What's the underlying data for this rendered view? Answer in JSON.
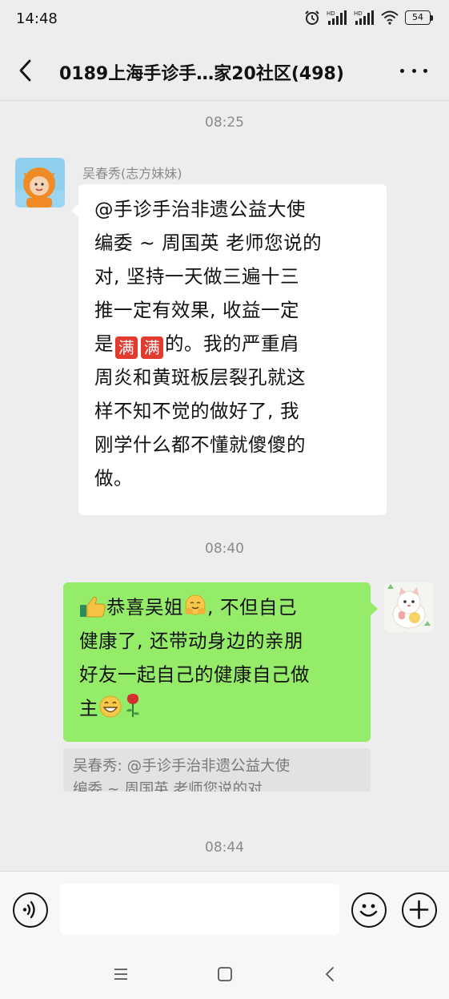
{
  "status_bar": {
    "time": "14:48",
    "battery": "54"
  },
  "nav": {
    "title": "0189上海手诊手…家20社区(498)"
  },
  "messages": {
    "timestamp_1": "08:25",
    "sender_name": "吴春秀(志方妹妹)",
    "incoming_text_lines": [
      "@手诊手治非遗公益大使",
      "编委 ~ 周国英 老师您说的",
      "对, 坚持一天做三遍十三",
      "推一定有效果, 收益一定"
    ],
    "incoming_emoji_char": "满",
    "incoming_line5_prefix": "是",
    "incoming_line5_suffix": "的。我的严重肩",
    "incoming_text_lines_tail": [
      "周炎和黄斑板层裂孔就这",
      "样不知不觉的做好了, 我",
      "刚学什么都不懂就傻傻的",
      "做。"
    ],
    "timestamp_2": "08:40",
    "outgoing_line1_a": "恭喜吴姐",
    "outgoing_line1_b": ", 不但自己",
    "outgoing_line2": "健康了, 还带动身边的亲朋",
    "outgoing_line3": "好友一起自己的健康自己做",
    "outgoing_line4": "主",
    "quote_line1": "吴春秀: @手诊手治非遗公益大使",
    "quote_line2": "编委 ~ 周国英 老师您说的对, …",
    "timestamp_3": "08:44"
  },
  "input": {
    "placeholder": ""
  },
  "icons": {
    "back": "chevron-left-icon",
    "more": "more-dots-icon",
    "voice": "voice-icon",
    "emoji": "smiley-icon",
    "plus": "plus-icon",
    "thumbs_up": "thumbs-up-emoji",
    "hug": "hug-emoji",
    "grin": "grin-emoji",
    "rose": "rose-emoji"
  },
  "colors": {
    "background": "#ededed",
    "outgoing_bubble": "#95ec69",
    "incoming_bubble": "#ffffff"
  }
}
